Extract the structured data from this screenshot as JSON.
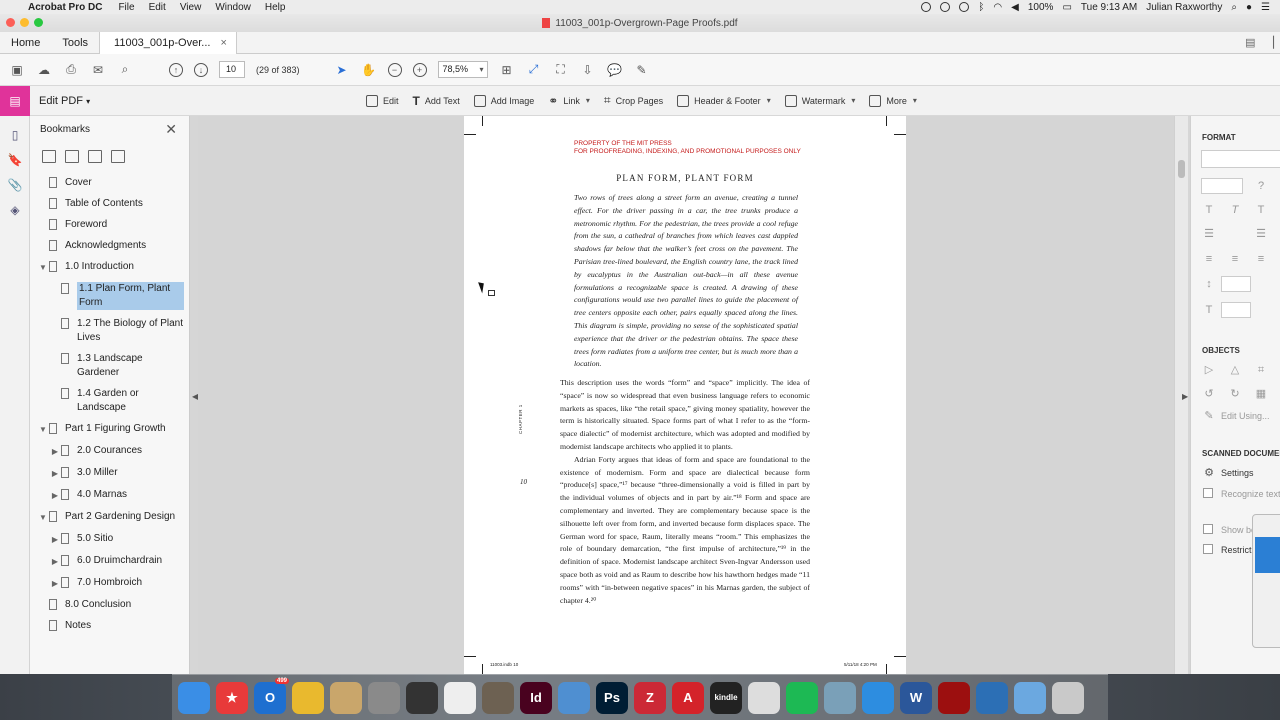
{
  "menubar": {
    "app_name": "Acrobat Pro DC",
    "items": [
      "File",
      "Edit",
      "View",
      "Window",
      "Help"
    ],
    "battery": "100%",
    "clock": "Tue 9:13 AM",
    "user": "Julian Raxworthy"
  },
  "window": {
    "title": "11003_001p-Overgrown-Page Proofs.pdf"
  },
  "tabs": {
    "home": "Home",
    "tools": "Tools",
    "doc": "11003_001p-Over..."
  },
  "toolbar": {
    "page_input": "10",
    "page_count": "(29 of 383)",
    "zoom": "78,5%"
  },
  "editbar": {
    "title": "Edit PDF",
    "tools": [
      {
        "label": "Edit",
        "icon": "edit-icon"
      },
      {
        "label": "Add Text",
        "icon": "add-text-icon"
      },
      {
        "label": "Add Image",
        "icon": "add-image-icon"
      },
      {
        "label": "Link",
        "icon": "link-icon"
      },
      {
        "label": "Crop Pages",
        "icon": "crop-icon"
      },
      {
        "label": "Header & Footer",
        "icon": "header-footer-icon"
      },
      {
        "label": "Watermark",
        "icon": "watermark-icon"
      },
      {
        "label": "More",
        "icon": "more-icon"
      }
    ]
  },
  "bookmarks": {
    "title": "Bookmarks",
    "items": [
      {
        "label": "Cover"
      },
      {
        "label": "Table of Contents"
      },
      {
        "label": "Foreword"
      },
      {
        "label": "Acknowledgments"
      },
      {
        "label": "1.0 Introduction"
      },
      {
        "label": "1.1 Plan Form, Plant Form"
      },
      {
        "label": "1.2 The Biology of Plant Lives"
      },
      {
        "label": "1.3 Landscape Gardener"
      },
      {
        "label": "1.4 Garden or Landscape"
      },
      {
        "label": "Part 1 Figuring Growth"
      },
      {
        "label": "2.0 Courances"
      },
      {
        "label": "3.0 Miller"
      },
      {
        "label": "4.0 Marnas"
      },
      {
        "label": "Part 2 Gardening Design"
      },
      {
        "label": "5.0 Sitio"
      },
      {
        "label": "6.0 Druimchardrain"
      },
      {
        "label": "7.0 Hombroich"
      },
      {
        "label": "8.0 Conclusion"
      },
      {
        "label": "Notes"
      }
    ]
  },
  "page": {
    "stamp_line1": "PROPERTY OF THE MIT PRESS",
    "stamp_line2": "FOR PROOFREADING, INDEXING, AND PROMOTIONAL PURPOSES ONLY",
    "title": "PLAN FORM, PLANT FORM",
    "intro": "Two rows of trees along a street form an avenue, creating a tunnel effect. For the driver passing in a car, the tree trunks produce a metronomic rhythm. For the pedestrian, the trees provide a cool refuge from the sun, a cathedral of branches from which leaves cast dappled shadows far below that the walker’s feet cross on the pavement. The Parisian tree-lined boulevard, the English country lane, the track lined by eucalyptus in the Australian out-back—in all these avenue formulations a recognizable space is created. A drawing of these configurations would use two parallel lines to guide the placement of tree centers opposite each other, pairs equally spaced along the lines. This diagram is simple, providing no sense of the sophisticated spatial experience that the driver or the pedestrian obtains. The space these trees form radiates from a uniform tree center, but is much more than a location.",
    "para1": "This description uses the words “form” and “space” implicitly. The idea of “space” is now so widespread that even business language refers to economic markets as spaces, like “the retail space,” giving money spatiality, however the term is historically situated. Space forms part of what I refer to as the “form-space dialectic” of modernist architecture, which was adopted and modified by modernist landscape architects who applied it to plants.",
    "para2": "Adrian Forty argues that ideas of form and space are foundational to the existence of modernism. Form and space are dialectical because form “produce[s] space,”¹⁷ because “three-dimensionally a void is filled in part by the individual volumes of objects and in part by air.”¹⁸ Form and space are complementary and inverted. They are complementary because space is the silhouette left over from form, and inverted because form displaces space. The German word for space, Raum, literally means “room.” This emphasizes the role of boundary demarcation, “the first impulse of architecture,”¹⁹ in the definition of space. Modernist landscape architect Sven-Ingvar Andersson used space both as void and as Raum to describe how his hawthorn hedges made “11 rooms” with “in-between negative spaces” in his Marnas garden, the subject of chapter 4.²⁰",
    "chapter_mark": "CHAPTER 1",
    "page_number": "10",
    "footer_left": "11003.indb 10",
    "footer_right": "5/11/18 4:20 PM"
  },
  "right_panel": {
    "format": "FORMAT",
    "objects": "OBJECTS",
    "edit_using": "Edit Using...",
    "scanned": "SCANNED DOCUMENTS",
    "settings": "Settings",
    "recognize": "Recognize text",
    "show_bounding": "Show bounding boxes",
    "restrict": "Restrict editing"
  },
  "dock": {
    "apps": [
      {
        "name": "Finder",
        "color": "#3a8ee6"
      },
      {
        "name": "Fantastical",
        "color": "#e83a3a"
      },
      {
        "name": "Outlook",
        "color": "#1e6fd0",
        "badge": "499"
      },
      {
        "name": "Chrome",
        "color": "#e9b92e"
      },
      {
        "name": "Notes",
        "color": "#c9a66b"
      },
      {
        "name": "System Preferences",
        "color": "#8a8a8a"
      },
      {
        "name": "Inkscape",
        "color": "#333333"
      },
      {
        "name": "File",
        "color": "#eeeeee"
      },
      {
        "name": "GIMP",
        "color": "#6d6152"
      },
      {
        "name": "InDesign",
        "color": "#49021f"
      },
      {
        "name": "Pencil",
        "color": "#4f8fd1"
      },
      {
        "name": "Photoshop",
        "color": "#001d34"
      },
      {
        "name": "Zotero",
        "color": "#cc2936"
      },
      {
        "name": "Acrobat",
        "color": "#d4232a"
      },
      {
        "name": "Kindle",
        "color": "#222222"
      },
      {
        "name": "Handshake",
        "color": "#dddddd"
      },
      {
        "name": "Spotify",
        "color": "#1db954"
      },
      {
        "name": "Preview",
        "color": "#7aa0b8"
      },
      {
        "name": "Safari",
        "color": "#2d8de0"
      },
      {
        "name": "Word",
        "color": "#2b579a"
      },
      {
        "name": "Acrobat Pro",
        "color": "#9c0f0f"
      },
      {
        "name": "QuickTime",
        "color": "#2c6fb5"
      },
      {
        "name": "Downloads",
        "color": "#6ba8e0"
      },
      {
        "name": "Trash",
        "color": "#c9c9c9"
      }
    ],
    "labels": {
      "Fantastical": "★",
      "Outlook": "O",
      "InDesign": "Id",
      "Photoshop": "Ps",
      "Zotero": "Z",
      "Acrobat": "A",
      "Kindle": "kindle",
      "Word": "W"
    }
  }
}
